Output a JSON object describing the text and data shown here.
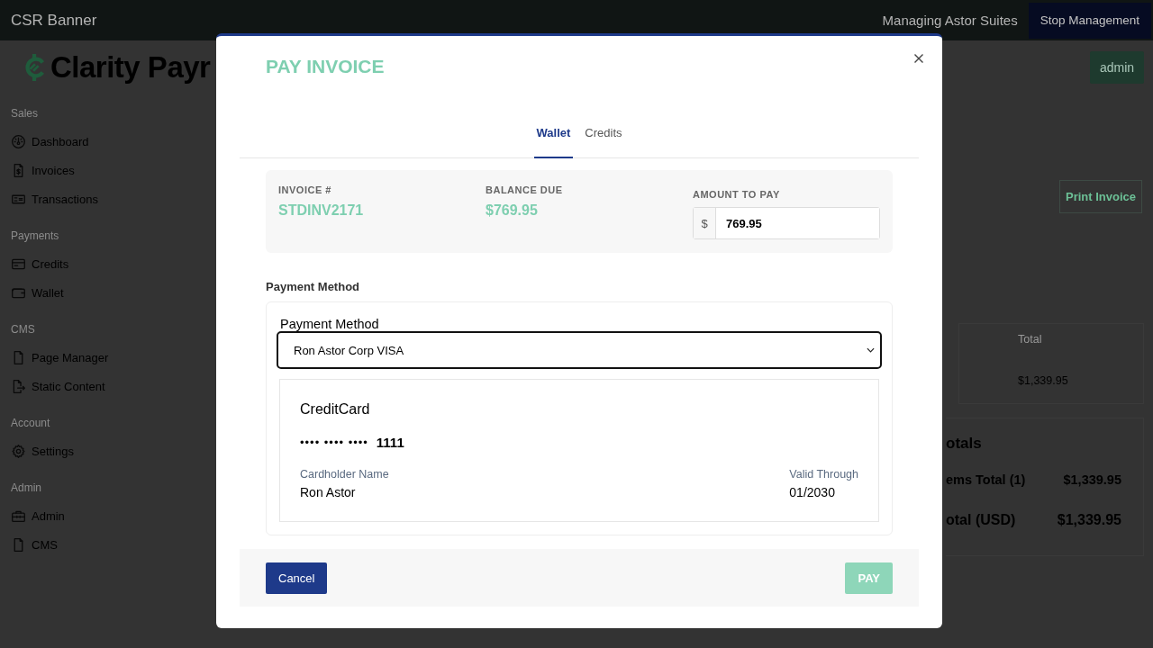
{
  "top_bar": {
    "title": "CSR Banner",
    "managing": "Managing Astor Suites",
    "stop_button": "Stop Management"
  },
  "header": {
    "logo": "Clarity Payr",
    "user_button": "admin"
  },
  "sidebar": {
    "sections": [
      {
        "heading": "Sales",
        "items": [
          {
            "label": "Dashboard",
            "kind": "gauge"
          },
          {
            "label": "Invoices",
            "kind": "invoice"
          },
          {
            "label": "Transactions",
            "kind": "bill"
          }
        ]
      },
      {
        "heading": "Payments",
        "items": [
          {
            "label": "Credits",
            "kind": "card"
          },
          {
            "label": "Wallet",
            "kind": "wallet"
          }
        ]
      },
      {
        "heading": "CMS",
        "items": [
          {
            "label": "Page Manager",
            "kind": "document"
          },
          {
            "label": "Static Content",
            "kind": "export"
          }
        ]
      },
      {
        "heading": "Account",
        "items": [
          {
            "label": "Settings",
            "kind": "gear"
          }
        ]
      },
      {
        "heading": "Admin",
        "items": [
          {
            "label": "Admin",
            "kind": "briefcase"
          },
          {
            "label": "CMS",
            "kind": "document"
          }
        ]
      }
    ]
  },
  "page": {
    "print_button": "Print Invoice",
    "items_table": {
      "columns": [
        "Total"
      ],
      "rows": [
        [
          "$1,339.95"
        ]
      ]
    },
    "totals": {
      "title": "otals",
      "rows": [
        {
          "label": "ems Total (1)",
          "value": "$1,339.95"
        },
        {
          "label": "otal (USD)",
          "value": "$1,339.95"
        }
      ]
    }
  },
  "modal": {
    "title": "PAY INVOICE",
    "tabs": [
      {
        "label": "Wallet",
        "selected": true
      },
      {
        "label": "Credits",
        "selected": false
      }
    ],
    "summary": {
      "invoice_label": "INVOICE #",
      "invoice": "STDINV2171",
      "balance_label": "BALANCE DUE",
      "balance": "$769.95",
      "amount_label": "AMOUNT TO PAY",
      "amount_prefix": "$",
      "amount": "769.95"
    },
    "payment_heading": "Payment Method",
    "method_label": "Payment Method",
    "method_value": "Ron Astor Corp VISA",
    "card": {
      "type": "CreditCard",
      "masked": "•••• •••• ••••",
      "last4": "1111",
      "holder_label": "Cardholder Name",
      "holder": "Ron Astor",
      "valid_label": "Valid Through",
      "valid": "01/2030"
    },
    "buttons": {
      "cancel": "Cancel",
      "pay": {
        "label": "PAY",
        "disabled": true
      }
    }
  }
}
